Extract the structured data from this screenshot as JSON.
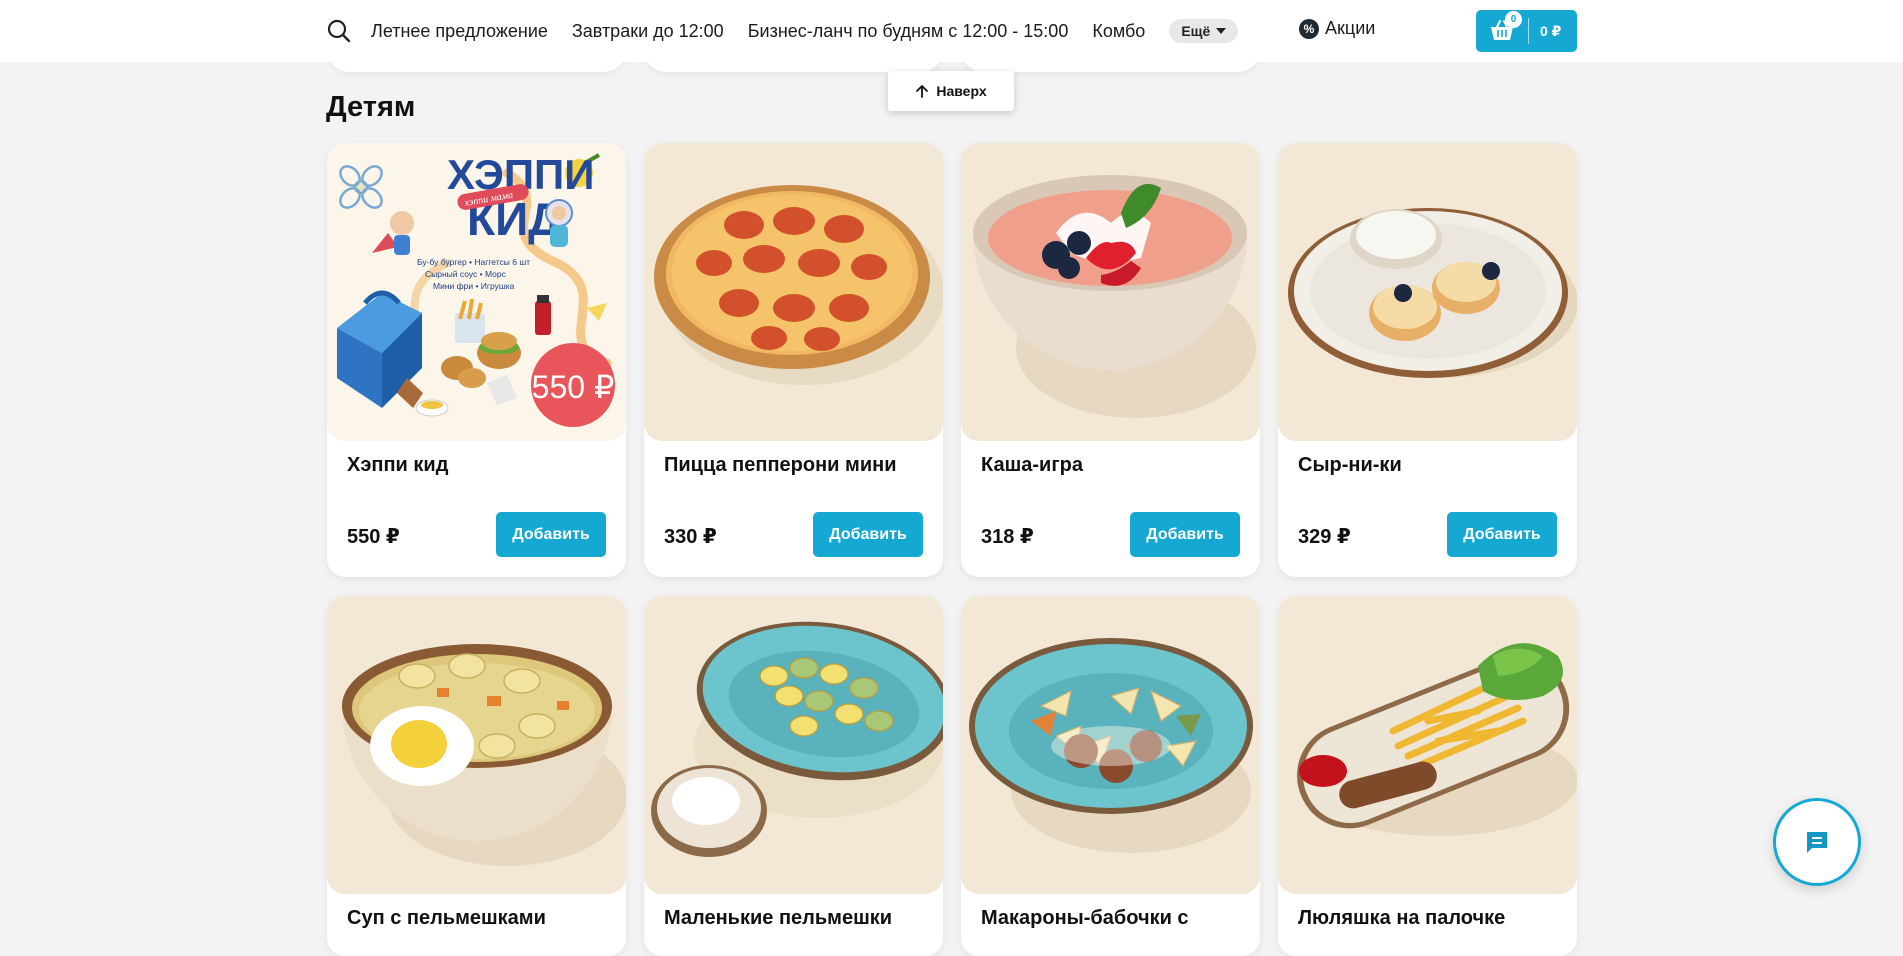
{
  "header": {
    "nav": [
      {
        "label": "Летнее предложение"
      },
      {
        "label": "Завтраки до 12:00"
      },
      {
        "label": "Бизнес-ланч по будням с 12:00 - 15:00"
      },
      {
        "label": "Комбо"
      }
    ],
    "more_label": "Ещё",
    "promo_label": "Акции",
    "promo_icon_glyph": "%",
    "cart": {
      "count": "0",
      "total": "0 ₽"
    }
  },
  "to_top_label": "Наверх",
  "section": {
    "title": "Детям"
  },
  "products": [
    {
      "name": "Хэппи кид",
      "price": "550 ₽",
      "add_label": "Добавить",
      "image_text": {
        "title": "ХЭППИ КИД",
        "ribbon": "хэппи мама",
        "contents": [
          "Бу-бу бургер • Наггетсы 6 шт",
          "Сырный соус • Морс",
          "Мини фри • Игрушка"
        ],
        "price_badge": "550 ₽"
      }
    },
    {
      "name": "Пицца пепперони мини",
      "price": "330 ₽",
      "add_label": "Добавить"
    },
    {
      "name": "Каша-игра",
      "price": "318 ₽",
      "add_label": "Добавить"
    },
    {
      "name": "Сыр-ни-ки",
      "price": "329 ₽",
      "add_label": "Добавить"
    },
    {
      "name": "Суп с пельмешками"
    },
    {
      "name": "Маленькие пельмешки"
    },
    {
      "name": "Макароны-бабочки с"
    },
    {
      "name": "Люляшка на палочке"
    }
  ],
  "colors": {
    "accent": "#14a8d3",
    "background": "#f3f3f3",
    "card_image_bg": "#f2e8d5"
  },
  "icons": [
    "search-icon",
    "chevron-down-icon",
    "percent-icon",
    "basket-icon",
    "arrow-up-icon",
    "chat-icon"
  ]
}
